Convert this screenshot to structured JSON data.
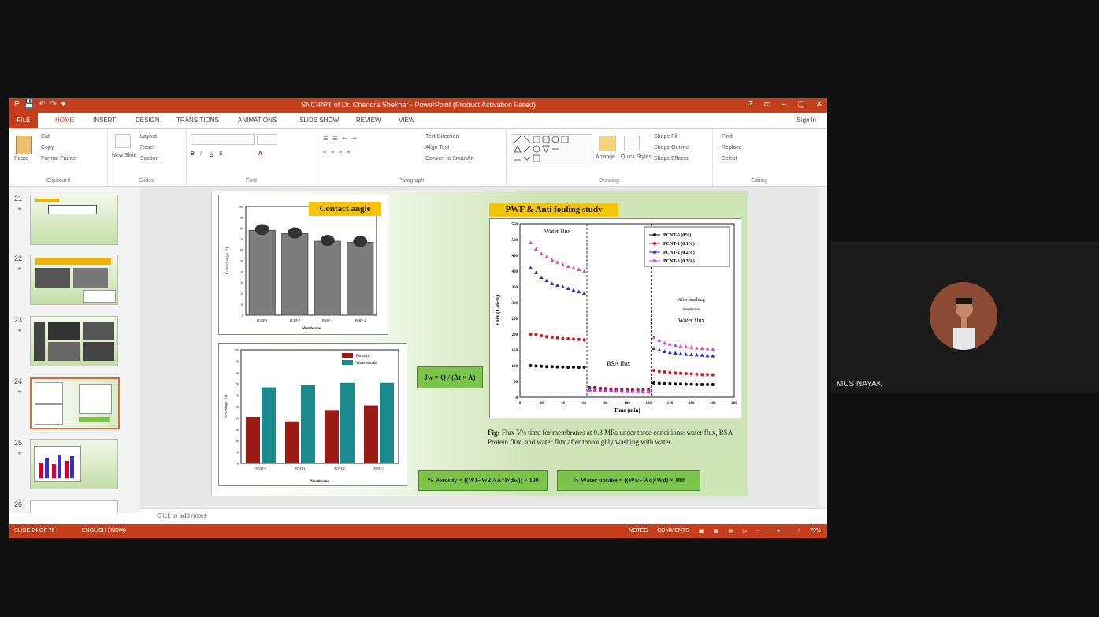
{
  "app": {
    "window_title": "SNC-PPT of Dr. Chandra Shekhar - PowerPoint (Product Activation Failed)",
    "window_controls": [
      "?",
      "▭",
      "–",
      "▢",
      "✕"
    ],
    "qat": [
      "P",
      "💾",
      "↶",
      "↷",
      "▾"
    ],
    "sign_in": "Sign in"
  },
  "tabs": [
    {
      "label": "FILE"
    },
    {
      "label": "HOME"
    },
    {
      "label": "INSERT"
    },
    {
      "label": "DESIGN"
    },
    {
      "label": "TRANSITIONS"
    },
    {
      "label": "ANIMATIONS"
    },
    {
      "label": "SLIDE SHOW"
    },
    {
      "label": "REVIEW"
    },
    {
      "label": "VIEW"
    }
  ],
  "ribbon": {
    "clipboard": {
      "paste": "Paste",
      "cut": "Cut",
      "copy": "Copy",
      "format_painter": "Format Painter",
      "label": "Clipboard"
    },
    "slides": {
      "new_slide": "New Slide",
      "layout": "Layout",
      "reset": "Reset",
      "section": "Section",
      "label": "Slides"
    },
    "font": {
      "label": "Font"
    },
    "paragraph": {
      "text_direction": "Text Direction",
      "align_text": "Align Text",
      "convert": "Convert to SmartArt",
      "label": "Paragraph"
    },
    "drawing": {
      "arrange": "Arrange",
      "quick_styles": "Quick Styles",
      "shape_fill": "Shape Fill",
      "shape_outline": "Shape Outline",
      "shape_effects": "Shape Effects",
      "label": "Drawing"
    },
    "editing": {
      "find": "Find",
      "replace": "Replace",
      "select": "Select",
      "label": "Editing"
    }
  },
  "slide_thumbnails": [
    {
      "number": "21"
    },
    {
      "number": "22"
    },
    {
      "number": "23"
    },
    {
      "number": "24"
    },
    {
      "number": "25"
    },
    {
      "number": "26"
    }
  ],
  "notes_placeholder": "Click to add notes",
  "status": {
    "slide": "SLIDE 24 OF 76",
    "language": "ENGLISH (INDIA)",
    "notes": "NOTES",
    "comments": "COMMENTS",
    "zoom": "79%"
  },
  "participant": {
    "name": "MCS NAYAK"
  },
  "slide_content": {
    "contact_angle": {
      "title": "Contact angle",
      "ylabel": "Contact angle (°)",
      "xlabel": "Membrane",
      "categories": [
        "PGRP-1",
        "PGRP-2",
        "PGRP-3",
        "PGRP-4"
      ],
      "values": [
        78,
        75,
        68,
        67
      ],
      "ylim": [
        0,
        100
      ],
      "y_ticks": [
        "0",
        "10",
        "20",
        "30",
        "40",
        "50",
        "60",
        "70",
        "80",
        "90",
        "100"
      ]
    },
    "porosity": {
      "ylabel": "Percentage (%)",
      "xlabel": "Membrane",
      "categories": [
        "PCNT-0",
        "PCNT-1",
        "PCNT-2",
        "PCNT-3"
      ],
      "legend": [
        "Porosity",
        "Water uptake"
      ],
      "porosity": [
        41,
        37,
        47,
        51
      ],
      "water_uptake": [
        67,
        69,
        71,
        71
      ],
      "ylim": [
        0,
        100
      ],
      "y_ticks": [
        "0",
        "10",
        "20",
        "30",
        "40",
        "50",
        "60",
        "70",
        "80",
        "90",
        "100"
      ],
      "colors": [
        "#9b1c15",
        "#1a8a8c"
      ]
    },
    "flux_chart": {
      "title": "PWF & Anti fouling study",
      "ylabel": "Flux (L/m²h)",
      "xlabel": "Time (min)",
      "x_ticks": [
        "0",
        "20",
        "40",
        "60",
        "80",
        "100",
        "120",
        "140",
        "160",
        "180",
        "200"
      ],
      "y_ticks": [
        "0",
        "50",
        "100",
        "150",
        "200",
        "250",
        "300",
        "350",
        "400",
        "450",
        "500",
        "550"
      ],
      "annotations": {
        "water_flux": "Water flux",
        "bsa_flux": "BSA flux",
        "after_washing_1": "After washing",
        "after_washing_2": "membrane",
        "after_washing_3": "Water flux"
      },
      "legend": [
        "PCNT-0 (0%)",
        "PCNT-1 (0.1%)",
        "PCNT-2 (0.2%)",
        "PCNT-3 (0.3%)"
      ],
      "colors": [
        "#111111",
        "#e0121b",
        "#1e30c8",
        "#e040d8"
      ]
    },
    "equations": {
      "flux": "Jw = Q / (Δt × A)",
      "porosity": "% Porosity = ((W1−W2)/(A×l×dw)) × 100",
      "water_uptake": "% Water uptake = ((Ww−Wd)/Wd) × 100"
    },
    "caption_label": "Fig:",
    "caption_text": "Flux V/s time for membranes at 0.3 MPa under three conditions: water flux, BSA Protein flux, and water flux after thoroughly washing with water."
  },
  "chart_data": [
    {
      "type": "bar",
      "title": "Contact angle",
      "categories": [
        "PGRP-1",
        "PGRP-2",
        "PGRP-3",
        "PGRP-4"
      ],
      "values": [
        78,
        75,
        68,
        67
      ],
      "xlabel": "Membrane",
      "ylabel": "Contact angle (°)",
      "ylim": [
        0,
        100
      ]
    },
    {
      "type": "bar",
      "categories": [
        "PCNT-0",
        "PCNT-1",
        "PCNT-2",
        "PCNT-3"
      ],
      "series": [
        {
          "name": "Porosity",
          "values": [
            41,
            37,
            47,
            51
          ]
        },
        {
          "name": "Water uptake",
          "values": [
            67,
            69,
            71,
            71
          ]
        }
      ],
      "xlabel": "Membrane",
      "ylabel": "Percentage (%)",
      "ylim": [
        0,
        100
      ],
      "legend": "top-right"
    },
    {
      "type": "scatter",
      "title": "PWF & Anti fouling study",
      "xlabel": "Time (min)",
      "ylabel": "Flux (L/m²h)",
      "xlim": [
        0,
        200
      ],
      "ylim": [
        0,
        550
      ],
      "legend": "top-right",
      "series": [
        {
          "name": "PCNT-0 (0%)",
          "x": [
            10,
            15,
            20,
            25,
            30,
            35,
            40,
            45,
            50,
            55,
            60,
            65,
            70,
            75,
            80,
            85,
            90,
            95,
            100,
            105,
            110,
            115,
            120,
            125,
            130,
            135,
            140,
            145,
            150,
            155,
            160,
            165,
            170,
            175,
            180
          ],
          "y": [
            100,
            99,
            98,
            97,
            97,
            96,
            96,
            95,
            95,
            95,
            95,
            30,
            30,
            28,
            27,
            26,
            25,
            25,
            24,
            24,
            23,
            23,
            23,
            45,
            44,
            43,
            43,
            42,
            42,
            41,
            41,
            40,
            40,
            40,
            40
          ]
        },
        {
          "name": "PCNT-1 (0.1%)",
          "x": [
            10,
            15,
            20,
            25,
            30,
            35,
            40,
            45,
            50,
            55,
            60,
            65,
            70,
            75,
            80,
            85,
            90,
            95,
            100,
            105,
            110,
            115,
            120,
            125,
            130,
            135,
            140,
            145,
            150,
            155,
            160,
            165,
            170,
            175,
            180
          ],
          "y": [
            200,
            198,
            195,
            192,
            190,
            188,
            186,
            185,
            184,
            183,
            182,
            28,
            27,
            26,
            26,
            25,
            25,
            24,
            24,
            23,
            23,
            22,
            22,
            85,
            82,
            80,
            78,
            77,
            76,
            75,
            74,
            73,
            72,
            72,
            71
          ]
        },
        {
          "name": "PCNT-2 (0.2%)",
          "x": [
            10,
            15,
            20,
            25,
            30,
            35,
            40,
            45,
            50,
            55,
            60,
            65,
            70,
            75,
            80,
            85,
            90,
            95,
            100,
            105,
            110,
            115,
            120,
            125,
            130,
            135,
            140,
            145,
            150,
            155,
            160,
            165,
            170,
            175,
            180
          ],
          "y": [
            410,
            395,
            380,
            370,
            360,
            355,
            350,
            345,
            340,
            335,
            330,
            25,
            24,
            24,
            23,
            23,
            22,
            22,
            21,
            21,
            20,
            20,
            20,
            155,
            150,
            145,
            142,
            140,
            138,
            136,
            135,
            134,
            133,
            132,
            131
          ]
        },
        {
          "name": "PCNT-3 (0.3%)",
          "x": [
            10,
            15,
            20,
            25,
            30,
            35,
            40,
            45,
            50,
            55,
            60,
            65,
            70,
            75,
            80,
            85,
            90,
            95,
            100,
            105,
            110,
            115,
            120,
            125,
            130,
            135,
            140,
            145,
            150,
            155,
            160,
            165,
            170,
            175,
            180
          ],
          "y": [
            490,
            470,
            455,
            445,
            435,
            428,
            420,
            415,
            410,
            405,
            400,
            22,
            21,
            21,
            20,
            20,
            19,
            19,
            18,
            18,
            18,
            17,
            17,
            190,
            180,
            172,
            168,
            165,
            162,
            160,
            158,
            156,
            155,
            154,
            152
          ]
        }
      ]
    }
  ]
}
